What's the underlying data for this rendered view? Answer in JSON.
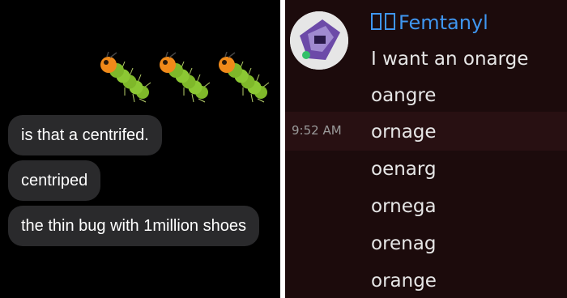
{
  "left_chat": {
    "emoji_name": "caterpillar-icon",
    "messages": [
      "is that a centrifed.",
      "centriped",
      "the thin bug with 1million shoes"
    ]
  },
  "right_chat": {
    "username": "Femtanyl",
    "username_color": "#3f96f0",
    "timestamp": "9:52 AM",
    "messages": [
      "I want an onarge",
      "oangre",
      "ornage",
      "oenarg",
      "ornega",
      "orenag",
      "orange"
    ]
  }
}
